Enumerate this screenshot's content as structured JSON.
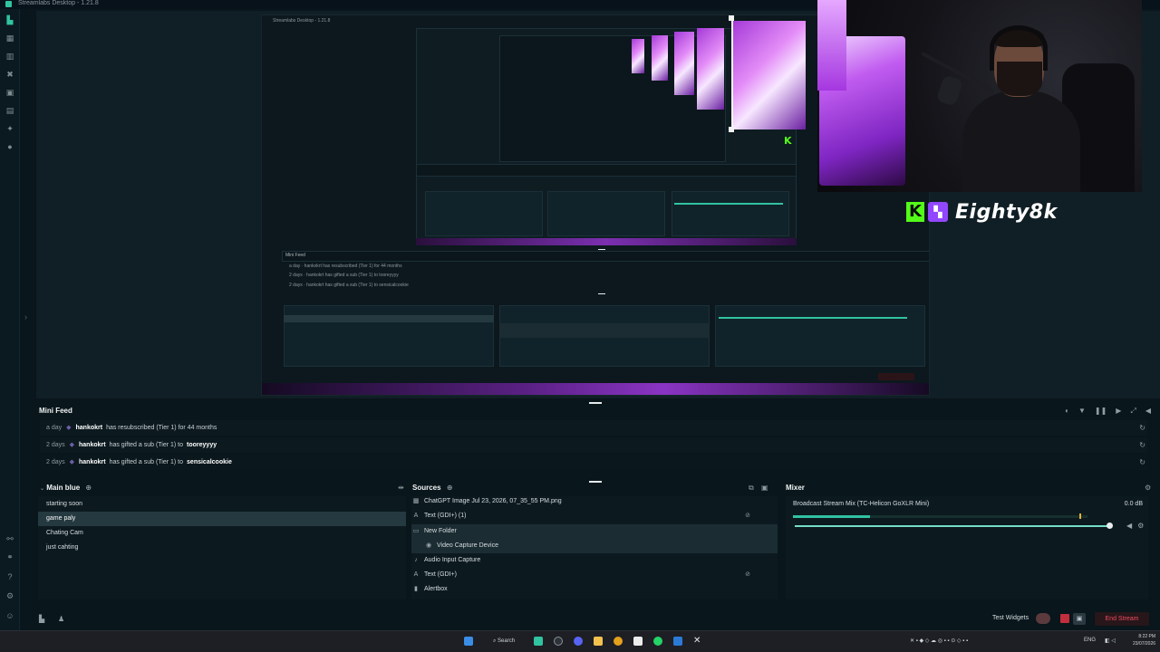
{
  "window": {
    "title": "Streamlabs Desktop - 1.21.8"
  },
  "preview": {
    "brand_name": "Eighty8k",
    "kick_icon": "kick-k-logo",
    "twitch_icon": "twitch-logo",
    "nested_title": "Streamlabs Desktop - 1.21.8"
  },
  "mini_feed": {
    "title": "Mini Feed",
    "events": [
      {
        "time": "a day",
        "user": "hankokrt",
        "text": "has resubscribed (Tier 1) for 44 months",
        "target": ""
      },
      {
        "time": "2 days",
        "user": "hankokrt",
        "text": "has gifted a sub (Tier 1) to",
        "target": "tooreyyyy"
      },
      {
        "time": "2 days",
        "user": "hankokrt",
        "text": "has gifted a sub (Tier 1) to",
        "target": "sensicalcookie"
      }
    ]
  },
  "scenes": {
    "title": "Main blue",
    "items": [
      {
        "label": "starting soon",
        "active": false
      },
      {
        "label": "game paly",
        "active": true
      },
      {
        "label": "Chating Cam",
        "active": false
      },
      {
        "label": "just cahting",
        "active": false
      }
    ]
  },
  "sources": {
    "title": "Sources",
    "items": [
      {
        "label": "ChatGPT Image Jul 23, 2026, 07_35_55 PM.png",
        "icon": "image-icon",
        "type": "item"
      },
      {
        "label": "Text (GDI+) (1)",
        "icon": "text-icon",
        "type": "item",
        "locked": true
      },
      {
        "label": "New Folder",
        "icon": "folder-icon",
        "type": "folder"
      },
      {
        "label": "Video Capture Device",
        "icon": "camera-icon",
        "type": "child"
      },
      {
        "label": "Audio Input Capture",
        "icon": "mic-icon",
        "type": "item"
      },
      {
        "label": "Text (GDI+)",
        "icon": "text-icon",
        "type": "item",
        "locked": true
      },
      {
        "label": "Alertbox",
        "icon": "alert-icon",
        "type": "item"
      }
    ]
  },
  "mixer": {
    "title": "Mixer",
    "source": "Broadcast Stream Mix (TC-Helicon GoXLR Mini)",
    "db": "0.0 dB",
    "level": 0.26,
    "volume": 0.99
  },
  "footer": {
    "test_widgets": "Test Widgets",
    "end_stream": "End Stream"
  },
  "taskbar": {
    "search": "Search",
    "lang": "ENG",
    "time": "8:22 PM",
    "date": "23/07/2026"
  },
  "colors": {
    "accent": "#31c3a2",
    "kick": "#53fc18",
    "twitch": "#9146ff",
    "end_stream": "#ef4b5c"
  }
}
